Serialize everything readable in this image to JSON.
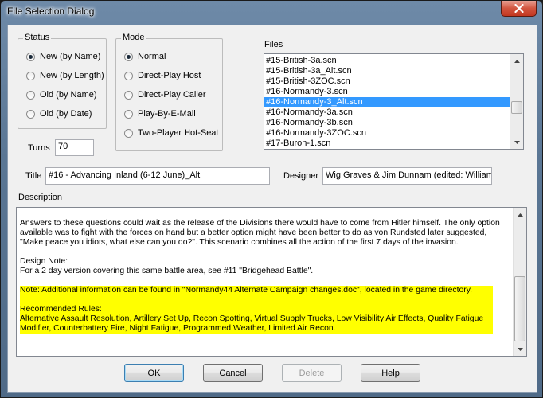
{
  "window": {
    "title": "File Selection Dialog"
  },
  "status": {
    "label": "Status",
    "options": [
      "New (by Name)",
      "New (by Length)",
      "Old (by Name)",
      "Old (by Date)"
    ],
    "selected": "New (by Name)"
  },
  "mode": {
    "label": "Mode",
    "options": [
      "Normal",
      "Direct-Play Host",
      "Direct-Play Caller",
      "Play-By-E-Mail",
      "Two-Player Hot-Seat"
    ],
    "selected": "Normal"
  },
  "turns": {
    "label": "Turns",
    "value": "70"
  },
  "files": {
    "label": "Files",
    "items": [
      "#15-British-3a.scn",
      "#15-British-3a_Alt.scn",
      "#15-British-3ZOC.scn",
      "#16-Normandy-3.scn",
      "#16-Normandy-3_Alt.scn",
      "#16-Normandy-3a.scn",
      "#16-Normandy-3b.scn",
      "#16-Normandy-3ZOC.scn",
      "#17-Buron-1.scn"
    ],
    "selected": "#16-Normandy-3_Alt.scn"
  },
  "title_field": {
    "label": "Title",
    "value": "#16 - Advancing Inland (6-12 June)_Alt"
  },
  "designer_field": {
    "label": "Designer",
    "value": "Wig Graves & Jim Dunnam (edited: Williams)"
  },
  "description": {
    "label": "Description",
    "lines": [
      "Answers to these questions could wait as the release of the Divisions there would have to come from Hitler himself. The only option",
      "available was to fight with the forces on hand but a better option might have been better to do as von Rundsted later suggested,",
      "\"Make peace you idiots, what else can you do?\". This scenario combines all the action of the first 7 days of the invasion.",
      "",
      "Design Note:",
      "For a 2 day version covering this same battle area, see #11 \"Bridgehead Battle\".",
      ""
    ],
    "highlighted_lines": [
      "Note: Additional information can be found in \"Normandy44 Alternate Campaign changes.doc\", located in the game directory.",
      "",
      "Recommended Rules:",
      "Alternative Assault Resolution, Artillery Set Up, Recon Spotting, Virtual Supply Trucks, Low Visibility Air Effects, Quality Fatigue",
      "Modifier, Counterbattery Fire, Night Fatigue, Programmed Weather, Limited Air Recon."
    ],
    "highlight_color": "#ffff00"
  },
  "buttons": {
    "ok": "OK",
    "cancel": "Cancel",
    "delete": "Delete",
    "help": "Help"
  },
  "colors": {
    "selection": "#3399ff",
    "close_button": "#c7432a"
  }
}
